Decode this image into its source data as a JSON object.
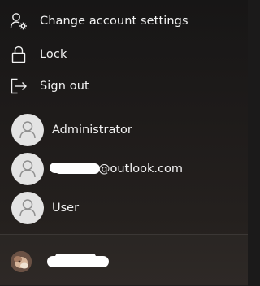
{
  "menu": {
    "items": [
      {
        "id": "change-account-settings",
        "label": "Change account settings",
        "icon": "person-gear-icon"
      },
      {
        "id": "lock",
        "label": "Lock",
        "icon": "lock-icon"
      },
      {
        "id": "sign-out",
        "label": "Sign out",
        "icon": "sign-out-icon"
      }
    ]
  },
  "accounts": [
    {
      "name": "Administrator",
      "icon": "default-user-avatar-icon"
    },
    {
      "name": "@outlook.com",
      "icon": "default-user-avatar-icon",
      "name_prefix_redacted": true
    },
    {
      "name": "User",
      "icon": "default-user-avatar-icon"
    }
  ],
  "current_user": {
    "photo_icon": "user-photo-avatar",
    "name_redacted": true
  },
  "colors": {
    "background": "#1b1a1a",
    "text": "#f2f2f2",
    "divider": "#6b6866",
    "avatar_bg": "#e3e3e3",
    "avatar_glyph": "#8f8f8f",
    "redaction": "#ffffff"
  }
}
